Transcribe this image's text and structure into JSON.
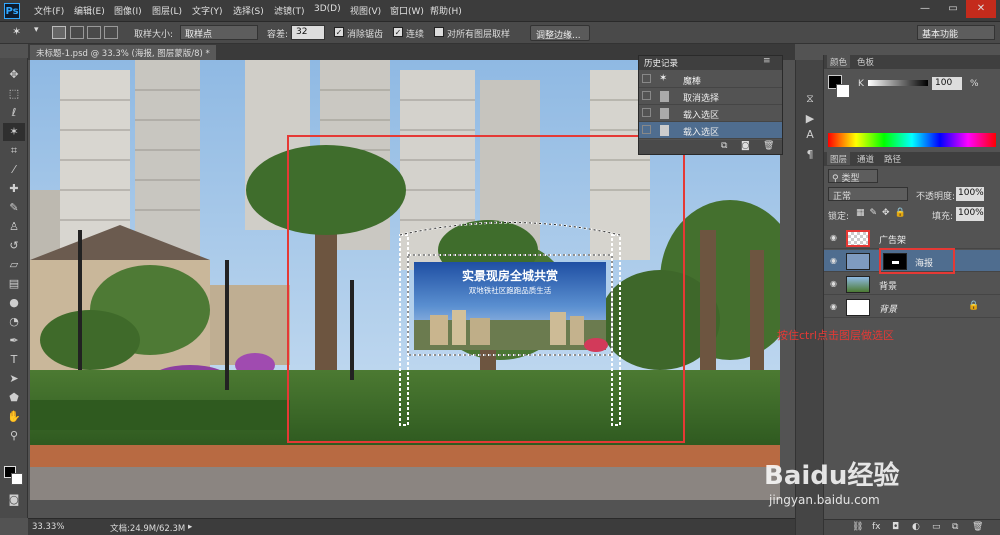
{
  "app": {
    "logo": "Ps"
  },
  "menubar": {
    "items": [
      "文件(F)",
      "编辑(E)",
      "图像(I)",
      "图层(L)",
      "文字(Y)",
      "选择(S)",
      "滤镜(T)",
      "3D(D)",
      "视图(V)",
      "窗口(W)",
      "帮助(H)"
    ],
    "window_controls": [
      "—",
      "▭",
      "✕"
    ]
  },
  "options": {
    "sample_size_label": "取样大小:",
    "sample_size_value": "取样点",
    "tolerance_label": "容差:",
    "tolerance_value": "32",
    "antialias_label": "消除锯齿",
    "contiguous_label": "连续",
    "sample_all_label": "对所有图层取样",
    "refine_edge_label": "调整边缘...",
    "workspace_value": "基本功能"
  },
  "document": {
    "tab_title": "未标题-1.psd @ 33.3% (海报, 图层蒙版/8) *",
    "zoom": "33.33%",
    "doc_size": "文档:24.9M/62.3M"
  },
  "billboard": {
    "title": "实景现房全城共赏",
    "subtitle": "双地铁社区跑跑品质生活"
  },
  "annotation": {
    "text": "按住ctrl点击图层做选区"
  },
  "history": {
    "title": "历史记录",
    "items": [
      {
        "label": "魔棒",
        "icon": "magic-wand-icon"
      },
      {
        "label": "取消选择",
        "icon": "doc-icon"
      },
      {
        "label": "载入选区",
        "icon": "doc-icon"
      },
      {
        "label": "载入选区",
        "icon": "doc-icon",
        "selected": true
      }
    ]
  },
  "color_panel": {
    "tabs": [
      "颜色",
      "色板"
    ],
    "channel": "K",
    "value": "100",
    "unit": "%"
  },
  "layers_panel": {
    "tabs": [
      "图层",
      "通道",
      "路径"
    ],
    "filter_label": "类型",
    "blend_mode": "正常",
    "opacity_label": "不透明度:",
    "opacity_value": "100%",
    "lock_label": "锁定:",
    "fill_label": "填充:",
    "fill_value": "100%",
    "layers": [
      {
        "name": "广告架",
        "selected": false
      },
      {
        "name": "海报",
        "selected": true
      },
      {
        "name": "背景",
        "selected": false
      },
      {
        "name": "背景",
        "selected": false,
        "locked": true
      }
    ]
  },
  "watermark": {
    "brand": "Baidu经验",
    "url": "jingyan.baidu.com"
  },
  "colors": {
    "highlight_red": "#e53935",
    "selection_blue": "#4f6d8f",
    "accent": "#31a8ff"
  }
}
